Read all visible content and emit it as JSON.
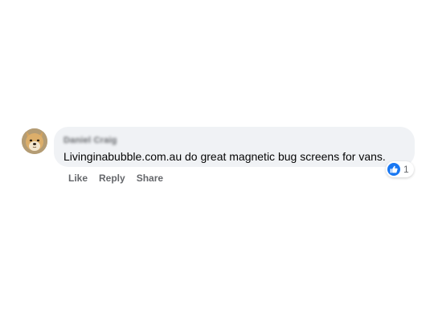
{
  "comment": {
    "author": "Daniel Craig",
    "text": "Livinginabubble.com.au do great magnetic bug screens for vans.",
    "reaction_count": "1",
    "reaction_icon": "like-icon",
    "actions": {
      "like": "Like",
      "reply": "Reply",
      "share": "Share"
    }
  },
  "colors": {
    "bubble": "#f0f2f5",
    "like_blue": "#1877f2",
    "secondary_text": "#65676b",
    "primary_text": "#050505"
  }
}
